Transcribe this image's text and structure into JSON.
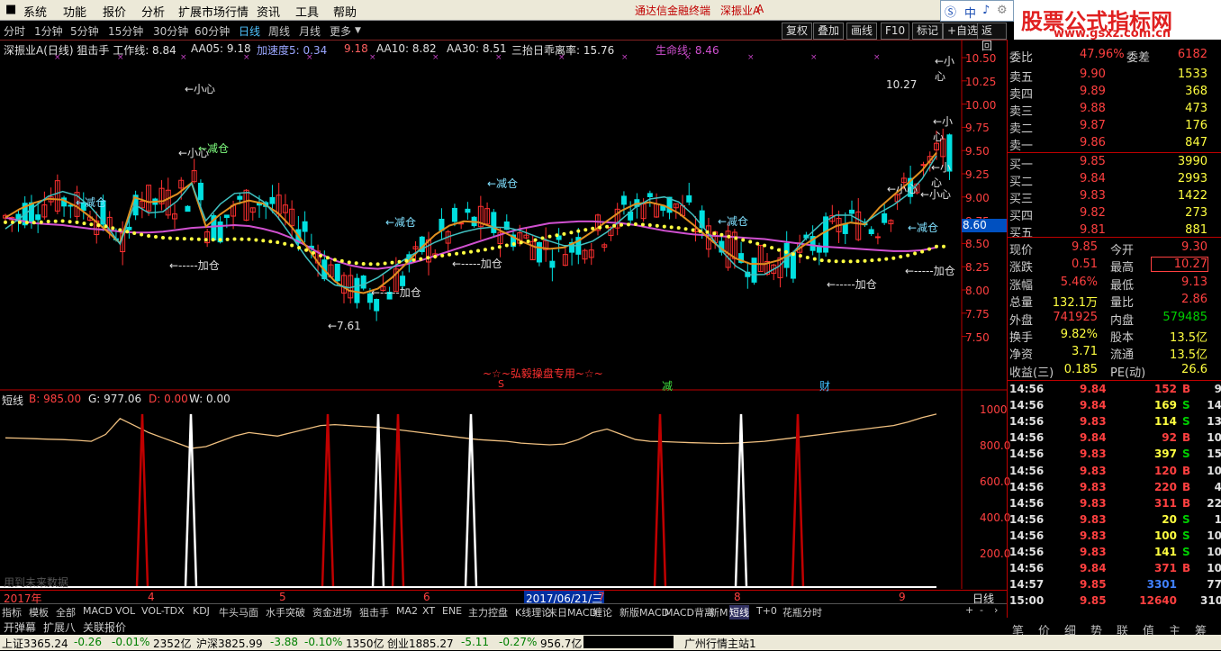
{
  "menu": {
    "items": [
      "系统",
      "功能",
      "报价",
      "分析",
      "扩展市场行情",
      "资讯",
      "工具",
      "帮助"
    ],
    "account": "通达信金融终端",
    "stock": "深振业A",
    "search": [
      "中",
      "♪"
    ],
    "logo_title": "股票公式指标网",
    "logo_url": "www.gsxz.com.cn"
  },
  "toolbar": {
    "periods": [
      "分时",
      "1分钟",
      "5分钟",
      "15分钟",
      "30分钟",
      "60分钟",
      "日线",
      "周线",
      "月线",
      "更多"
    ],
    "active_period": "日线",
    "buttons": [
      "复权",
      "叠加",
      "画线",
      "F10",
      "标记",
      "+自选",
      "返回"
    ]
  },
  "indicator_line": {
    "title": "深振业A(日线) 狙击手 工作线: 8.84",
    "aa05": "AA05: 9.18",
    "speed": "加速度5: 0.34",
    "val918": "9.18",
    "aa10": "AA10: 8.82",
    "aa30": "AA30: 8.51",
    "ratio": "三抬日乖离率: 15.76",
    "life": "生命线: 8.46"
  },
  "price_axis": [
    "10.50",
    "10.25",
    "10.00",
    "9.75",
    "9.50",
    "9.25",
    "9.00",
    "8.75",
    "8.50",
    "8.25",
    "8.00",
    "7.75",
    "7.50"
  ],
  "current_price_tag": "8.60",
  "annotations": {
    "xiaoxin": "←小心",
    "jiancang": "←减仓",
    "jiacang": "←-----加仓",
    "low": "←7.61",
    "high": "10.27",
    "watermark": "~☆~弘毅操盘专用~☆~",
    "s_mark": "S",
    "jian": "减",
    "cai": "财"
  },
  "sub_indicator": {
    "name": "短线",
    "b": "B: 985.00",
    "g": "G: 977.06",
    "d": "D: 0.00",
    "w": "W: 0.00",
    "axis": [
      "1000",
      "800.0",
      "600.0",
      "400.0",
      "200.0"
    ],
    "note": "用到未来数据"
  },
  "dates": {
    "year": "2017年",
    "months": [
      "4",
      "5",
      "6",
      "7",
      "8",
      "9"
    ],
    "cursor": "2017/06/21/三",
    "period": "日线"
  },
  "order_book": {
    "weibi": "委比",
    "weibi_val": "47.96%",
    "weicha": "委差",
    "weicha_val": "6182",
    "sells": [
      {
        "label": "卖五",
        "price": "9.90",
        "vol": "1533"
      },
      {
        "label": "卖四",
        "price": "9.89",
        "vol": "368"
      },
      {
        "label": "卖三",
        "price": "9.88",
        "vol": "473"
      },
      {
        "label": "卖二",
        "price": "9.87",
        "vol": "176"
      },
      {
        "label": "卖一",
        "price": "9.86",
        "vol": "847"
      }
    ],
    "buys": [
      {
        "label": "买一",
        "price": "9.85",
        "vol": "3990"
      },
      {
        "label": "买二",
        "price": "9.84",
        "vol": "2993"
      },
      {
        "label": "买三",
        "price": "9.83",
        "vol": "1422"
      },
      {
        "label": "买四",
        "price": "9.82",
        "vol": "273"
      },
      {
        "label": "买五",
        "price": "9.81",
        "vol": "881"
      }
    ]
  },
  "quote": [
    {
      "l1": "现价",
      "v1": "9.85",
      "l2": "今开",
      "v2": "9.30"
    },
    {
      "l1": "涨跌",
      "v1": "0.51",
      "l2": "最高",
      "v2": "10.27"
    },
    {
      "l1": "涨幅",
      "v1": "5.46%",
      "l2": "最低",
      "v2": "9.13"
    },
    {
      "l1": "总量",
      "v1": "132.1万",
      "l2": "量比",
      "v2": "2.86"
    },
    {
      "l1": "外盘",
      "v1": "741925",
      "l2": "内盘",
      "v2": "579485"
    },
    {
      "l1": "换手",
      "v1": "9.82%",
      "l2": "股本",
      "v2": "13.5亿"
    },
    {
      "l1": "净资",
      "v1": "3.71",
      "l2": "流通",
      "v2": "13.5亿"
    },
    {
      "l1": "收益(三)",
      "v1": "0.185",
      "l2": "PE(动)",
      "v2": "26.6"
    }
  ],
  "trades": [
    {
      "t": "14:56",
      "p": "9.84",
      "v": "152",
      "bs": "B",
      "n": "9"
    },
    {
      "t": "14:56",
      "p": "9.84",
      "v": "169",
      "bs": "S",
      "n": "14"
    },
    {
      "t": "14:56",
      "p": "9.83",
      "v": "114",
      "bs": "S",
      "n": "13"
    },
    {
      "t": "14:56",
      "p": "9.84",
      "v": "92",
      "bs": "B",
      "n": "10"
    },
    {
      "t": "14:56",
      "p": "9.83",
      "v": "397",
      "bs": "S",
      "n": "15"
    },
    {
      "t": "14:56",
      "p": "9.83",
      "v": "120",
      "bs": "B",
      "n": "10"
    },
    {
      "t": "14:56",
      "p": "9.83",
      "v": "220",
      "bs": "B",
      "n": "4"
    },
    {
      "t": "14:56",
      "p": "9.83",
      "v": "311",
      "bs": "B",
      "n": "22"
    },
    {
      "t": "14:56",
      "p": "9.83",
      "v": "20",
      "bs": "S",
      "n": "1"
    },
    {
      "t": "14:56",
      "p": "9.83",
      "v": "100",
      "bs": "S",
      "n": "10"
    },
    {
      "t": "14:56",
      "p": "9.83",
      "v": "141",
      "bs": "S",
      "n": "10"
    },
    {
      "t": "14:56",
      "p": "9.84",
      "v": "371",
      "bs": "B",
      "n": "10"
    },
    {
      "t": "14:57",
      "p": "9.85",
      "v": "3301",
      "bs": "",
      "n": "77"
    },
    {
      "t": "15:00",
      "p": "9.85",
      "v": "12640",
      "bs": "",
      "n": "310"
    }
  ],
  "tabs": [
    "指标",
    "模板",
    "全部",
    "MACD",
    "VOL",
    "VOL-TDX",
    "KDJ",
    "牛头马面",
    "水手突破",
    "资金进场",
    "狙击手",
    "MA2",
    "XT",
    "ENE",
    "主力控盘",
    "K线理论",
    "末日MACD",
    "缠论",
    "新版MACD",
    "MACD背离",
    "新M",
    "短线",
    "T+0",
    "花瓶分时"
  ],
  "active_tab": "短线",
  "bottom_buttons": [
    "开弹幕",
    "扩展八",
    "关联报价"
  ],
  "panel_tabs": [
    "笔",
    "价",
    "细",
    "势",
    "联",
    "值",
    "主",
    "筹"
  ],
  "status": {
    "sh": "上证3365.24",
    "sh_chg": "-0.26",
    "sh_pct": "-0.01%",
    "sh_amt": "2352亿",
    "sz": "沪深3825.99",
    "sz_chg": "-3.88",
    "sz_pct": "-0.10%",
    "sz_amt": "1350亿",
    "cy": "创业1885.27",
    "cy_chg": "-5.11",
    "cy_pct": "-0.27%",
    "cy_amt": "956.7亿",
    "server": "广州行情主站1"
  },
  "colors": {
    "up": "#ff3030",
    "down": "#00e0e0",
    "ma_purple": "#d050d0",
    "ma_orange": "#e09020",
    "ma_cyan": "#40c0c0",
    "dots": "#ffff40",
    "accent_red": "#c00000"
  }
}
